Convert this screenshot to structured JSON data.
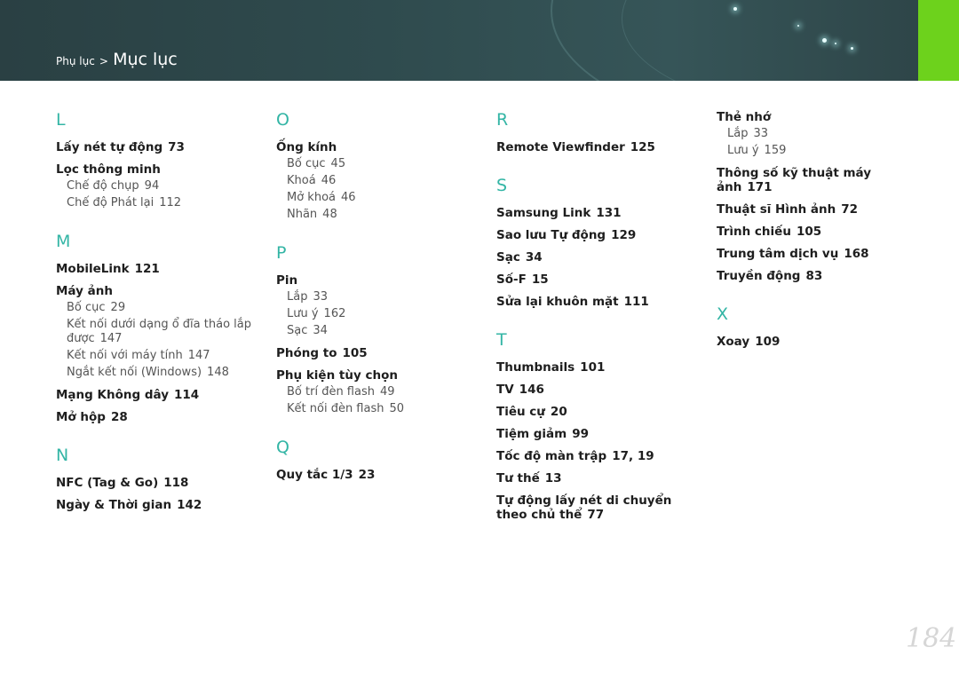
{
  "header": {
    "breadcrumb_parent": "Phụ lục",
    "breadcrumb_separator": ">",
    "breadcrumb_current": "Mục lục"
  },
  "columns": [
    [
      {
        "letter": "L",
        "entries": [
          {
            "term": "Lấy nét tự động",
            "page": "73",
            "subs": []
          },
          {
            "term": "Lọc thông minh",
            "page": "",
            "subs": [
              {
                "term": "Chế độ chụp",
                "page": "94"
              },
              {
                "term": "Chế độ Phát lại",
                "page": "112"
              }
            ]
          }
        ]
      },
      {
        "letter": "M",
        "entries": [
          {
            "term": "MobileLink",
            "page": "121",
            "subs": []
          },
          {
            "term": "Máy ảnh",
            "page": "",
            "subs": [
              {
                "term": "Bố cục",
                "page": "29"
              },
              {
                "term": "Kết nối dưới dạng ổ đĩa tháo lắp được",
                "page": "147"
              },
              {
                "term": "Kết nối với máy tính",
                "page": "147"
              },
              {
                "term": "Ngắt kết nối (Windows)",
                "page": "148"
              }
            ]
          },
          {
            "term": "Mạng Không dây",
            "page": "114",
            "subs": []
          },
          {
            "term": "Mở hộp",
            "page": "28",
            "subs": []
          }
        ]
      },
      {
        "letter": "N",
        "entries": [
          {
            "term": "NFC (Tag & Go)",
            "page": "118",
            "subs": []
          },
          {
            "term": "Ngày & Thời gian",
            "page": "142",
            "subs": []
          }
        ]
      }
    ],
    [
      {
        "letter": "O",
        "entries": [
          {
            "term": "Ống kính",
            "page": "",
            "subs": [
              {
                "term": "Bố cục",
                "page": "45"
              },
              {
                "term": "Khoá",
                "page": "46"
              },
              {
                "term": "Mở khoá",
                "page": "46"
              },
              {
                "term": "Nhãn",
                "page": "48"
              }
            ]
          }
        ]
      },
      {
        "letter": "P",
        "entries": [
          {
            "term": "Pin",
            "page": "",
            "subs": [
              {
                "term": "Lắp",
                "page": "33"
              },
              {
                "term": "Lưu ý",
                "page": "162"
              },
              {
                "term": "Sạc",
                "page": "34"
              }
            ]
          },
          {
            "term": "Phóng to",
            "page": "105",
            "subs": []
          },
          {
            "term": "Phụ kiện tùy chọn",
            "page": "",
            "subs": [
              {
                "term": "Bố trí đèn flash",
                "page": "49"
              },
              {
                "term": "Kết nối đèn flash",
                "page": "50"
              }
            ]
          }
        ]
      },
      {
        "letter": "Q",
        "entries": [
          {
            "term": "Quy tắc 1/3",
            "page": "23",
            "subs": []
          }
        ]
      }
    ],
    [
      {
        "letter": "R",
        "entries": [
          {
            "term": "Remote Viewfinder",
            "page": "125",
            "subs": []
          }
        ]
      },
      {
        "letter": "S",
        "entries": [
          {
            "term": "Samsung Link",
            "page": "131",
            "subs": []
          },
          {
            "term": "Sao lưu Tự động",
            "page": "129",
            "subs": []
          },
          {
            "term": "Sạc",
            "page": "34",
            "subs": []
          },
          {
            "term": "Số-F",
            "page": "15",
            "subs": []
          },
          {
            "term": "Sửa lại khuôn mặt",
            "page": "111",
            "subs": []
          }
        ]
      },
      {
        "letter": "T",
        "entries": [
          {
            "term": "Thumbnails",
            "page": "101",
            "subs": []
          },
          {
            "term": "TV",
            "page": "146",
            "subs": []
          },
          {
            "term": "Tiêu cự",
            "page": "20",
            "subs": []
          },
          {
            "term": "Tiệm giảm",
            "page": "99",
            "subs": []
          },
          {
            "term": "Tốc độ màn trập",
            "page": "17, 19",
            "subs": []
          },
          {
            "term": "Tư thế",
            "page": "13",
            "subs": []
          },
          {
            "term": "Tự động lấy nét di chuyển theo chủ thể",
            "page": "77",
            "subs": []
          }
        ]
      }
    ],
    [
      {
        "letter": "",
        "entries": [
          {
            "term": "Thẻ nhớ",
            "page": "",
            "subs": [
              {
                "term": "Lắp",
                "page": "33"
              },
              {
                "term": "Lưu ý",
                "page": "159"
              }
            ]
          },
          {
            "term": "Thông số kỹ thuật máy ảnh",
            "page": "171",
            "subs": []
          },
          {
            "term": "Thuật sĩ Hình ảnh",
            "page": "72",
            "subs": []
          },
          {
            "term": "Trình chiếu",
            "page": "105",
            "subs": []
          },
          {
            "term": "Trung tâm dịch vụ",
            "page": "168",
            "subs": []
          },
          {
            "term": "Truyền động",
            "page": "83",
            "subs": []
          }
        ]
      },
      {
        "letter": "X",
        "entries": [
          {
            "term": "Xoay",
            "page": "109",
            "subs": []
          }
        ]
      }
    ]
  ],
  "page_number": "184",
  "colors": {
    "accent_teal": "#33b5a5",
    "header_bg": "#2f4b4e",
    "green_tab": "#6dd21c"
  }
}
